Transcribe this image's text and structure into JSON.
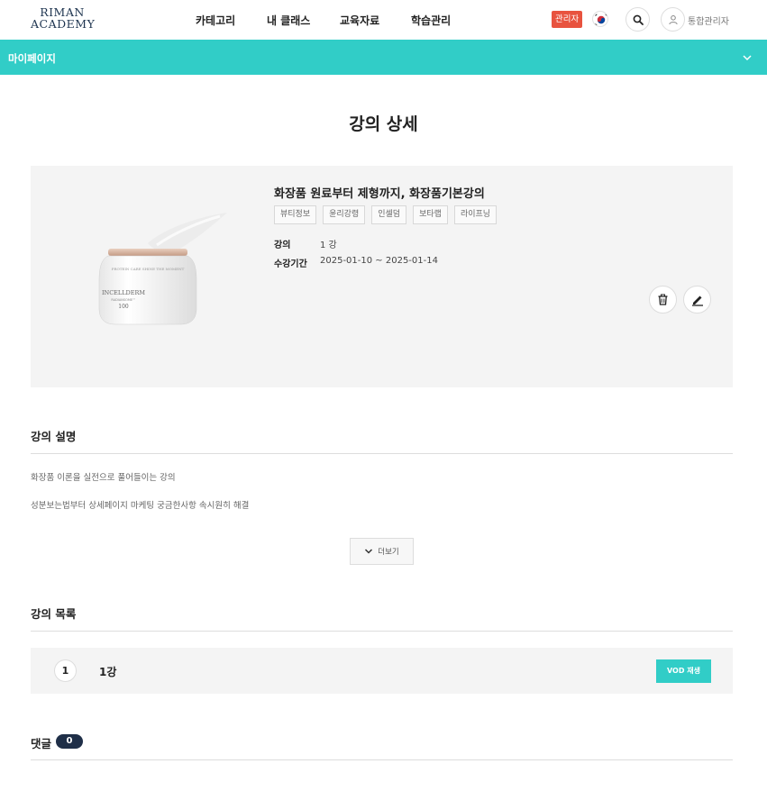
{
  "logo": {
    "line1": "RIMAN",
    "line2": "ACADEMY"
  },
  "nav": {
    "items": [
      "카테고리",
      "내 클래스",
      "교육자료",
      "학습관리"
    ]
  },
  "header": {
    "admin_badge": "관리자",
    "user_name": "통합관리자"
  },
  "mypage_bar": {
    "label": "마이페이지"
  },
  "page_title": "강의 상세",
  "course": {
    "title": "화장품 원료부터 제형까지, 화장품기본강의",
    "tags": [
      "뷰티정보",
      "윤리강령",
      "인셀덤",
      "보타랩",
      "라이프닝"
    ],
    "lecture_label": "강의",
    "lecture_value": "1 강",
    "period_label": "수강기간",
    "period_value": "2025-01-10 ~ 2025-01-14",
    "image_text": {
      "brand": "INCELLDERM",
      "sub": "RADIANSOME™",
      "num": "100",
      "cap": "PROTEIN CARE SHINE THE MOMENT"
    }
  },
  "description": {
    "title": "강의 설명",
    "lines": [
      "화장품 이론을 실전으로 풀어들이는 강의",
      "성분보는법부터 상세페이지 마케팅 궁금한사항 속시원히 해결"
    ],
    "more_label": "더보기"
  },
  "lecture_list": {
    "title": "강의 목록",
    "items": [
      {
        "num": "1",
        "name": "1강",
        "button": "VOD 재생"
      }
    ]
  },
  "comments": {
    "title": "댓글",
    "count": "0"
  },
  "colors": {
    "accent": "#31cdc7",
    "badge_red": "#e8533f",
    "navy": "#1f2f48"
  }
}
